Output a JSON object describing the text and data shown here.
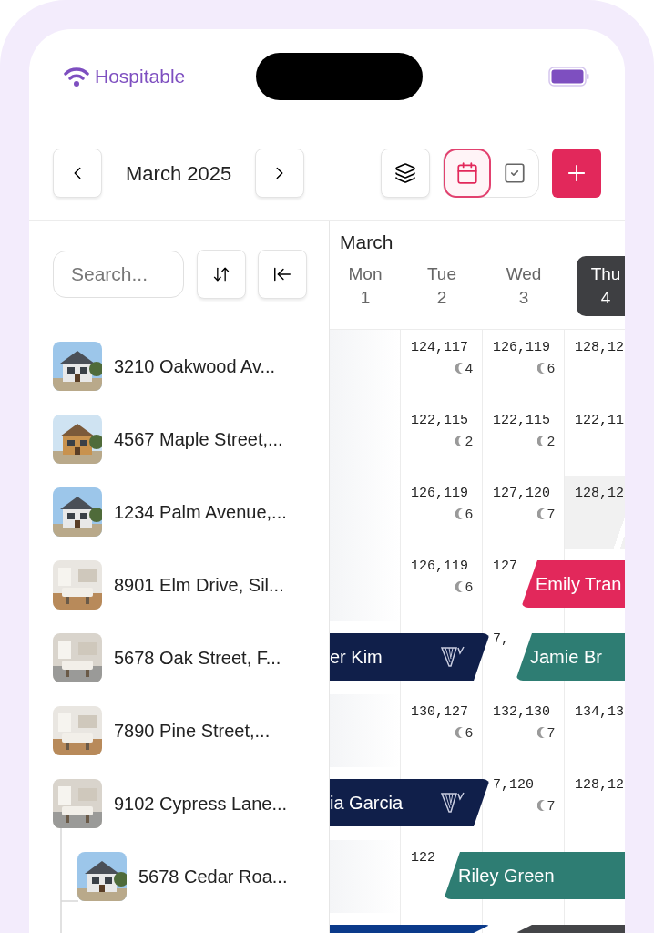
{
  "status_bar": {
    "carrier": "Hospitable"
  },
  "toolbar": {
    "month": "March 2025",
    "views": [
      {
        "kind": "calendar",
        "selected": true
      },
      {
        "kind": "tasks",
        "selected": false
      }
    ]
  },
  "sidebar": {
    "search": {
      "placeholder": "Search..."
    },
    "properties": [
      {
        "name": "3210 Oakwood Av..."
      },
      {
        "name": "4567 Maple Street,..."
      },
      {
        "name": "1234 Palm Avenue,..."
      },
      {
        "name": "8901 Elm Drive, Sil..."
      },
      {
        "name": "5678 Oak Street, F..."
      },
      {
        "name": "7890 Pine Street,..."
      },
      {
        "name": "9102 Cypress Lane...",
        "children": [
          {
            "name": "5678 Cedar Roa..."
          }
        ]
      }
    ]
  },
  "calendar": {
    "month": "March",
    "days": [
      {
        "label": "Mon",
        "date": "1",
        "selected": false
      },
      {
        "label": "Tue",
        "date": "2",
        "selected": false
      },
      {
        "label": "Wed",
        "date": "3",
        "selected": false
      },
      {
        "label": "Thu",
        "date": "4",
        "selected": true
      }
    ],
    "rows": [
      {
        "cells": [
          {
            "rate": "124,117",
            "nights": "4",
            "blocked": false
          },
          {
            "rate": "126,119",
            "nights": "6",
            "blocked": false
          },
          {
            "rate": "128,12",
            "blocked": false
          }
        ]
      },
      {
        "cells": [
          {
            "rate": "122,115",
            "nights": "2",
            "blocked": false
          },
          {
            "rate": "122,115",
            "nights": "2",
            "blocked": false
          },
          {
            "rate": "122,11",
            "blocked": false
          }
        ]
      },
      {
        "cells": [
          {
            "rate": "126,119",
            "nights": "6",
            "blocked": false
          },
          {
            "rate": "127,120",
            "nights": "7",
            "blocked": false
          },
          {
            "rate": "128,12",
            "blocked": true
          }
        ]
      },
      {
        "cells": [
          {
            "rate": "126,119",
            "nights": "6",
            "blocked": false
          },
          {
            "rate": "127",
            "blocked": false
          },
          null
        ],
        "bookings": [
          {
            "guest": "Emily Tran",
            "color": "#e2285b",
            "from_left": false,
            "channel_logo": false
          }
        ]
      },
      {
        "cells": [
          null,
          {
            "rate": "7,",
            "blocked": false
          },
          null
        ],
        "bookings": [
          {
            "guest": "er Kim",
            "color": "#101f4a",
            "from_left": true,
            "channel_logo": true
          },
          {
            "guest": "Jamie Br",
            "color": "#2e7d73",
            "from_left": false,
            "channel_logo": false
          }
        ]
      },
      {
        "cells": [
          {
            "rate": "130,127",
            "nights": "6",
            "blocked": false
          },
          {
            "rate": "132,130",
            "nights": "7",
            "blocked": false
          },
          {
            "rate": "134,13",
            "blocked": false
          }
        ]
      },
      {
        "cells": [
          null,
          {
            "rate": "7,120",
            "nights": "7",
            "blocked": false
          },
          {
            "rate": "128,12",
            "blocked": false
          }
        ],
        "bookings": [
          {
            "guest": "ia Garcia",
            "color": "#101f4a",
            "from_left": true,
            "channel_logo": true
          }
        ]
      },
      {
        "cells": [
          {
            "rate": "122",
            "blocked": false
          },
          null,
          null
        ],
        "bookings": [
          {
            "guest": "Riley Green",
            "color": "#2e7d73",
            "from_left": false,
            "channel_logo": false
          }
        ]
      },
      {
        "cells": [
          null,
          null,
          null
        ],
        "bookings": [
          {
            "color": "#0b3a8a",
            "from_left": true,
            "channel_logo": false
          },
          {
            "color": "#444548",
            "from_left": false,
            "channel_logo": false
          }
        ]
      }
    ]
  }
}
